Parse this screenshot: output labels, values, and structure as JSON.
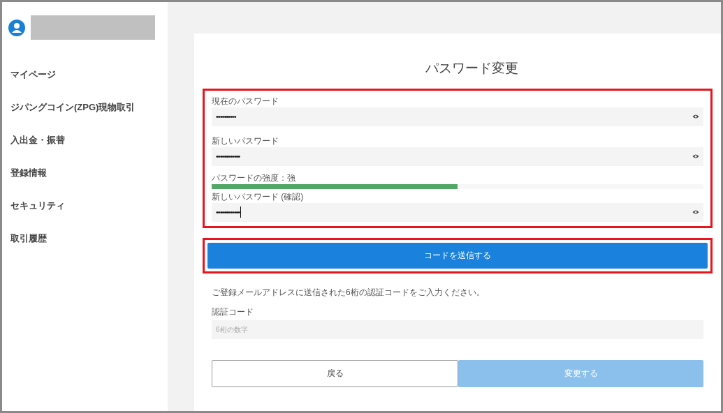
{
  "sidebar": {
    "items": [
      {
        "label": "マイページ"
      },
      {
        "label": "ジパングコイン(ZPG)現物取引"
      },
      {
        "label": "入出金・振替"
      },
      {
        "label": "登録情報"
      },
      {
        "label": "セキュリティ"
      },
      {
        "label": "取引履歴"
      }
    ]
  },
  "form": {
    "title": "パスワード変更",
    "fields": [
      {
        "kind": "password",
        "label": "現在のパスワード",
        "value": "••••••••••",
        "focused": false
      },
      {
        "kind": "password",
        "label": "新しいパスワード",
        "value": "••••••••••••",
        "focused": false
      },
      {
        "kind": "strength",
        "label": "パスワードの強度：強",
        "level": 0.5
      },
      {
        "kind": "password",
        "label": "新しいパスワード (確認)",
        "value": "••••••••••••",
        "focused": true
      }
    ],
    "send_button": "コードを送信する",
    "instruction": "ご登録メールアドレスに送信された6桁の認証コードをご入力ください。",
    "code_field": {
      "label": "認証コード",
      "placeholder": "6桁の数字"
    },
    "back_button": {
      "label": "戻る",
      "disabled": false
    },
    "submit_button": {
      "label": "変更する",
      "disabled": true
    }
  }
}
